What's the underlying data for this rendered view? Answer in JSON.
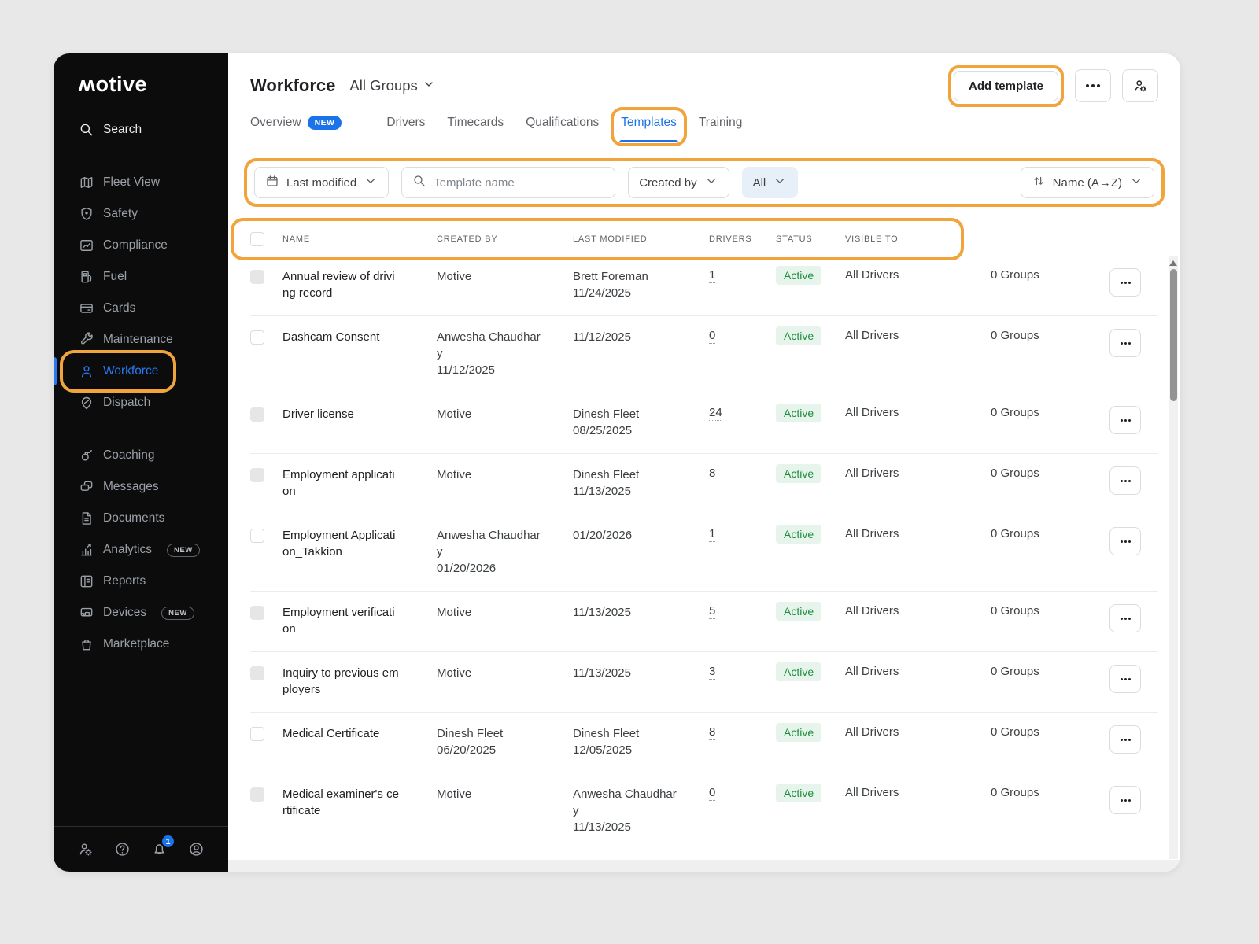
{
  "colors": {
    "accent_blue": "#1a73e8",
    "annotation_orange": "#f1a33c",
    "active_badge_bg": "#e7f4ec",
    "active_badge_text": "#1e8e3e",
    "sidebar_bg": "#0c0c0d"
  },
  "sidebar": {
    "logo": "ʍotive",
    "search_label": "Search",
    "primary_items": [
      {
        "label": "Fleet View",
        "icon": "map-icon"
      },
      {
        "label": "Safety",
        "icon": "shield-icon"
      },
      {
        "label": "Compliance",
        "icon": "compliance-icon"
      },
      {
        "label": "Fuel",
        "icon": "fuel-icon"
      },
      {
        "label": "Cards",
        "icon": "card-icon"
      },
      {
        "label": "Maintenance",
        "icon": "wrench-icon"
      },
      {
        "label": "Workforce",
        "icon": "person-icon",
        "active": true,
        "annotated": true
      },
      {
        "label": "Dispatch",
        "icon": "dispatch-icon"
      }
    ],
    "secondary_items": [
      {
        "label": "Coaching",
        "icon": "whistle-icon"
      },
      {
        "label": "Messages",
        "icon": "messages-icon"
      },
      {
        "label": "Documents",
        "icon": "document-icon"
      },
      {
        "label": "Analytics",
        "icon": "analytics-icon",
        "badge": "NEW"
      },
      {
        "label": "Reports",
        "icon": "report-icon"
      },
      {
        "label": "Devices",
        "icon": "device-icon",
        "badge": "NEW"
      },
      {
        "label": "Marketplace",
        "icon": "bag-icon"
      }
    ],
    "footer_icons": [
      {
        "icon": "user-gear-icon"
      },
      {
        "icon": "help-icon"
      },
      {
        "icon": "bell-icon",
        "badge": "1"
      },
      {
        "icon": "profile-icon"
      }
    ]
  },
  "header": {
    "title": "Workforce",
    "group_selector": "All Groups",
    "add_template_label": "Add template"
  },
  "tabs": [
    {
      "label": "Overview",
      "badge": "NEW",
      "divider_after": true
    },
    {
      "label": "Drivers"
    },
    {
      "label": "Timecards"
    },
    {
      "label": "Qualifications"
    },
    {
      "label": "Templates",
      "active": true,
      "annotated": true
    },
    {
      "label": "Training"
    }
  ],
  "filters": {
    "date_filter": "Last modified",
    "search_placeholder": "Template name",
    "created_by": "Created by",
    "status_filter": "All",
    "sort": "Name (A→Z)"
  },
  "table": {
    "columns": [
      "NAME",
      "CREATED BY",
      "LAST MODIFIED",
      "DRIVERS",
      "STATUS",
      "VISIBLE TO"
    ],
    "rows": [
      {
        "name": "Annual review of driving record",
        "created_by": "Motive",
        "created_date": "",
        "modified_by": "Brett Foreman",
        "modified_date": "11/24/2025",
        "drivers": "1",
        "status": "Active",
        "visible_to": "All Drivers",
        "groups": "0 Groups",
        "motive_template": true
      },
      {
        "name": "Dashcam Consent",
        "created_by": "Anwesha Chaudhary",
        "created_date": "11/12/2025",
        "modified_by": "",
        "modified_date": "11/12/2025",
        "drivers": "0",
        "status": "Active",
        "visible_to": "All Drivers",
        "groups": "0 Groups",
        "motive_template": false
      },
      {
        "name": "Driver license",
        "created_by": "Motive",
        "created_date": "",
        "modified_by": "Dinesh Fleet",
        "modified_date": "08/25/2025",
        "drivers": "24",
        "status": "Active",
        "visible_to": "All Drivers",
        "groups": "0 Groups",
        "motive_template": true
      },
      {
        "name": "Employment application",
        "created_by": "Motive",
        "created_date": "",
        "modified_by": "Dinesh Fleet",
        "modified_date": "11/13/2025",
        "drivers": "8",
        "status": "Active",
        "visible_to": "All Drivers",
        "groups": "0 Groups",
        "motive_template": true
      },
      {
        "name": "Employment Application_Takkion",
        "created_by": "Anwesha Chaudhary",
        "created_date": "01/20/2026",
        "modified_by": "",
        "modified_date": "01/20/2026",
        "drivers": "1",
        "status": "Active",
        "visible_to": "All Drivers",
        "groups": "0 Groups",
        "motive_template": false
      },
      {
        "name": "Employment verification",
        "created_by": "Motive",
        "created_date": "",
        "modified_by": "",
        "modified_date": "11/13/2025",
        "drivers": "5",
        "status": "Active",
        "visible_to": "All Drivers",
        "groups": "0 Groups",
        "motive_template": true
      },
      {
        "name": "Inquiry to previous employers",
        "created_by": "Motive",
        "created_date": "",
        "modified_by": "",
        "modified_date": "11/13/2025",
        "drivers": "3",
        "status": "Active",
        "visible_to": "All Drivers",
        "groups": "0 Groups",
        "motive_template": true
      },
      {
        "name": "Medical Certificate",
        "created_by": "Dinesh Fleet",
        "created_date": "06/20/2025",
        "modified_by": "Dinesh Fleet",
        "modified_date": "12/05/2025",
        "drivers": "8",
        "status": "Active",
        "visible_to": "All Drivers",
        "groups": "0 Groups",
        "motive_template": false
      },
      {
        "name": "Medical examiner's certificate",
        "created_by": "Motive",
        "created_date": "",
        "modified_by": "Anwesha Chaudhary",
        "modified_date": "11/13/2025",
        "drivers": "0",
        "status": "Active",
        "visible_to": "All Drivers",
        "groups": "0 Groups",
        "motive_template": true
      }
    ]
  }
}
